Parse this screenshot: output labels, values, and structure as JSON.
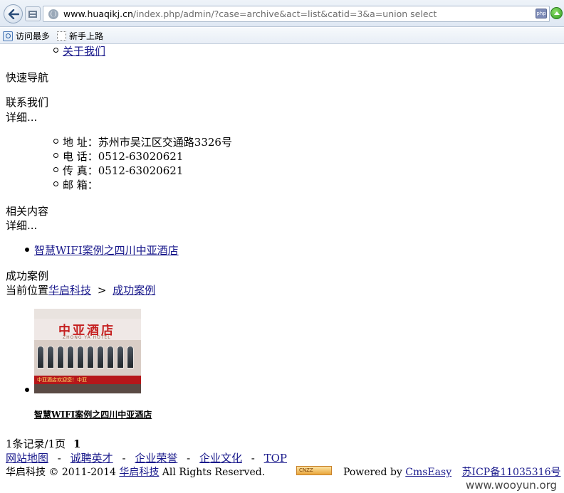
{
  "browser": {
    "url_host": "www.huaqikj.cn",
    "url_path": "/index.php/admin/?case=archive&act=list&catid=3&a=union select",
    "bookmarks": [
      {
        "label": "访问最多",
        "icon": "visited-icon"
      },
      {
        "label": "新手上路",
        "icon": "blank-page-icon"
      }
    ],
    "icons": [
      "back-arrow-icon",
      "tab-list-icon",
      "globe-icon",
      "php-icon",
      "go-icon"
    ]
  },
  "page": {
    "about_link": "关于我们",
    "quick_nav": "快速导航",
    "contact": {
      "title": "联系我们",
      "more": "详细...",
      "items": [
        "地 址：苏州市吴江区交通路3326号",
        "电 话：0512-63020621",
        "传 真：0512-63020621",
        "邮 箱："
      ]
    },
    "related": {
      "title": "相关内容",
      "more": "详细...",
      "items": [
        "智慧WIFI案例之四川中亚酒店"
      ]
    },
    "section_title": "成功案例",
    "breadcrumb": {
      "prefix": "当前位置",
      "home": "华启科技",
      "separator": ">",
      "current": "成功案例"
    },
    "case": {
      "image_sign": "中亚酒店",
      "image_sign_sub": "ZHONG YA HOTEL",
      "image_led": "中亚酒店欢迎您！中亚",
      "title": "智慧WIFI案例之四川中亚酒店"
    },
    "pagination": {
      "summary": "1条记录/1页",
      "current": "1"
    },
    "footer": {
      "links": [
        "网站地图",
        "诚聘英才",
        "企业荣誉",
        "企业文化",
        "TOP"
      ],
      "separator": "-",
      "copyright_prefix": "华启科技 © 2011-2014",
      "company_link": "华启科技",
      "rights": "All Rights Reserved.",
      "cnzz": "CNZZ",
      "powered_prefix": "Powered by",
      "powered_link": "CmsEasy",
      "icp": "苏ICP备11035316号"
    }
  },
  "watermark": "www.wooyun.org"
}
